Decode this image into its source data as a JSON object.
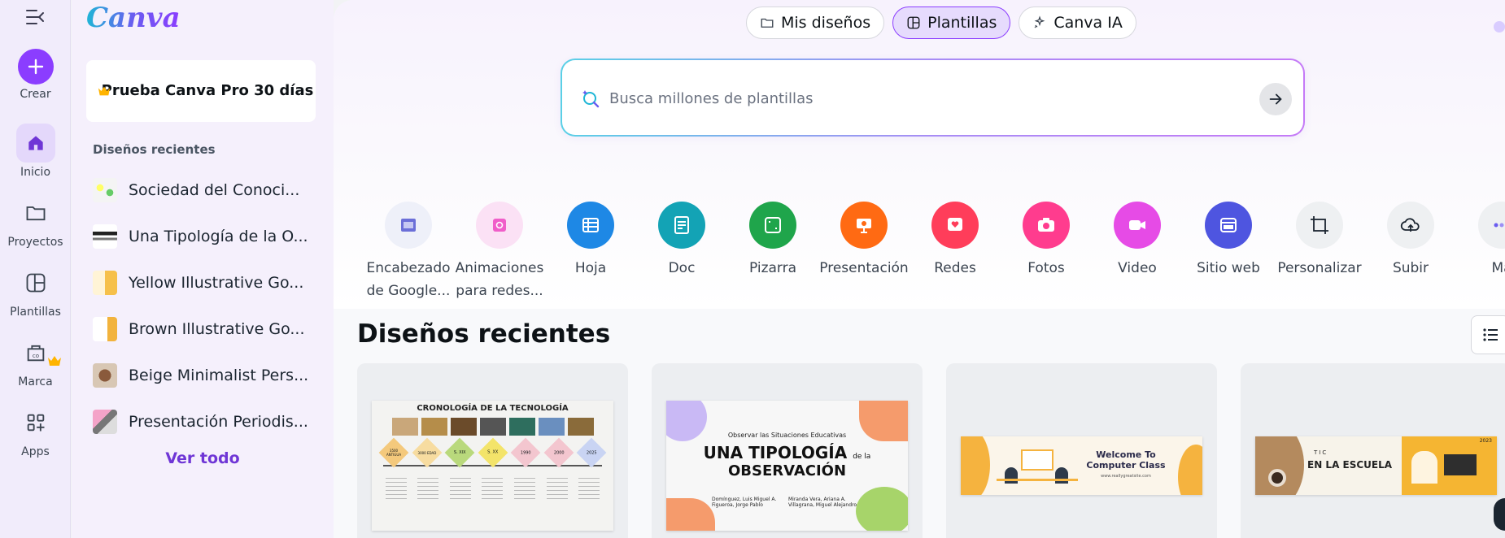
{
  "rail": {
    "create": "Crear",
    "home": "Inicio",
    "projects": "Proyectos",
    "templates": "Plantillas",
    "brand": "Marca",
    "apps": "Apps"
  },
  "panel": {
    "logo": "Canva",
    "pro_card": "Prueba Canva Pro 30 días",
    "recent_heading": "Diseños recientes",
    "recent_items": [
      {
        "title": "Sociedad del Conoci..."
      },
      {
        "title": "Una Tipología de la O..."
      },
      {
        "title": "Yellow Illustrative Go..."
      },
      {
        "title": "Brown Illustrative Go..."
      },
      {
        "title": "Beige Minimalist Pers..."
      },
      {
        "title": "Presentación Periodis..."
      }
    ],
    "see_all": "Ver todo"
  },
  "tabs": [
    {
      "label": "Mis diseños",
      "icon": "folder-icon"
    },
    {
      "label": "Plantillas",
      "icon": "template-icon",
      "active": true
    },
    {
      "label": "Canva IA",
      "icon": "sparkle-icon"
    }
  ],
  "search": {
    "placeholder": "Busca millones de plantillas"
  },
  "shortcuts": [
    {
      "label": "Encabezado de Google...",
      "icon": "header-icon",
      "color": "#eef0f9"
    },
    {
      "label": "Animaciones para redes...",
      "icon": "animation-icon",
      "color": "#fbe1f5"
    },
    {
      "label": "Hoja",
      "icon": "sheet-icon",
      "color": "#1e88e5"
    },
    {
      "label": "Doc",
      "icon": "doc-icon",
      "color": "#13a3b5"
    },
    {
      "label": "Pizarra",
      "icon": "whiteboard-icon",
      "color": "#1fa54b"
    },
    {
      "label": "Presentación",
      "icon": "presentation-icon",
      "color": "#ff6a13"
    },
    {
      "label": "Redes",
      "icon": "social-icon",
      "color": "#ff3d5a"
    },
    {
      "label": "Fotos",
      "icon": "camera-icon",
      "color": "#ff3c8e"
    },
    {
      "label": "Video",
      "icon": "video-icon",
      "color": "#e64be6"
    },
    {
      "label": "Sitio web",
      "icon": "website-icon",
      "color": "#4e55e0"
    },
    {
      "label": "Personalizar",
      "icon": "resize-icon",
      "color": "#eef0f2"
    },
    {
      "label": "Subir",
      "icon": "upload-icon",
      "color": "#eef0f2"
    },
    {
      "label": "Má",
      "icon": "more-icon",
      "color": "#eef0f2"
    }
  ],
  "main": {
    "section_title": "Diseños recientes"
  },
  "cards": [
    {
      "title": "CRONOLOGÍA DE LA TECNOLOGÍA",
      "labels": [
        "3500 ANTIGUA",
        "3000 EDAD",
        "S. XIX",
        "S. XX",
        "1990",
        "2000",
        "2025"
      ]
    },
    {
      "kicker": "Observar las Situaciones Educativas",
      "title_line1": "UNA TIPOLOGÍA",
      "title_sub": "de la",
      "title_line2": "OBSERVACIÓN",
      "authors_left": "Domínguez, Luis Miguel A. Figueroa, Jorge Pablo",
      "authors_right": "Miranda Vera, Ariana A. Villagrana, Miguel Alejandro"
    },
    {
      "title": "Welcome To Computer Class",
      "sub": "www.reallygreatsite.com"
    },
    {
      "kicker": "TIC",
      "title": "EN LA ESCUELA",
      "year": "2023"
    }
  ]
}
